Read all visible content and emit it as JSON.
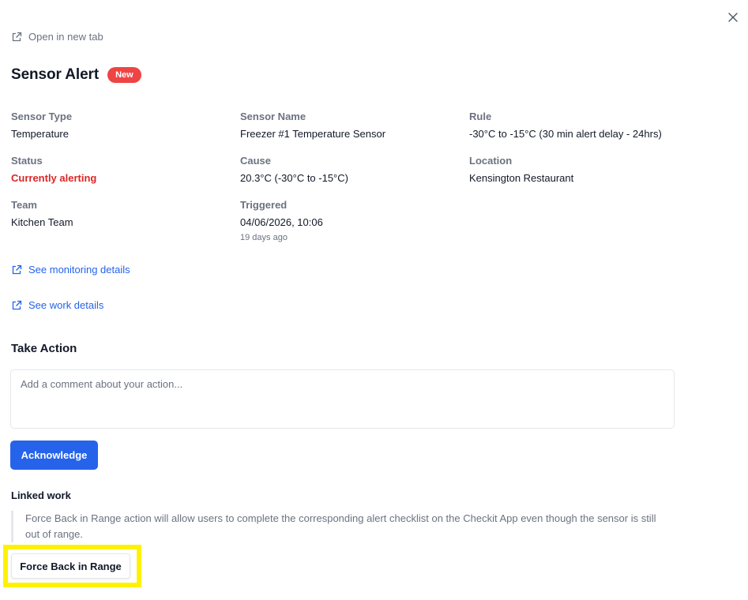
{
  "header": {
    "open_in_new_tab": "Open in new tab",
    "title": "Sensor Alert",
    "badge": "New"
  },
  "fields": {
    "sensor_type": {
      "label": "Sensor Type",
      "value": "Temperature"
    },
    "sensor_name": {
      "label": "Sensor Name",
      "value": "Freezer #1 Temperature Sensor"
    },
    "rule": {
      "label": "Rule",
      "value": "-30°C to -15°C (30 min alert delay - 24hrs)"
    },
    "status": {
      "label": "Status",
      "value": "Currently alerting"
    },
    "cause": {
      "label": "Cause",
      "value": "20.3°C (-30°C to -15°C)"
    },
    "location": {
      "label": "Location",
      "value": "Kensington Restaurant"
    },
    "team": {
      "label": "Team",
      "value": "Kitchen Team"
    },
    "triggered": {
      "label": "Triggered",
      "value": "04/06/2026, 10:06",
      "relative": "19 days ago"
    }
  },
  "links": {
    "monitoring": "See monitoring details",
    "work": "See work details"
  },
  "take_action": {
    "title": "Take Action",
    "comment_placeholder": "Add a comment about your action...",
    "acknowledge_label": "Acknowledge"
  },
  "linked_work": {
    "title": "Linked work",
    "note": "Force Back in Range action will allow users to complete the corresponding alert checklist on the Checkit App even though the sensor is still out of range.",
    "force_button_label": "Force Back in Range"
  },
  "colors": {
    "accent": "#2563eb",
    "alert": "#dc2626",
    "badge": "#ef4444",
    "highlight": "#fff200"
  },
  "icons": {
    "close": "close-icon",
    "external_link": "external-link-icon"
  }
}
